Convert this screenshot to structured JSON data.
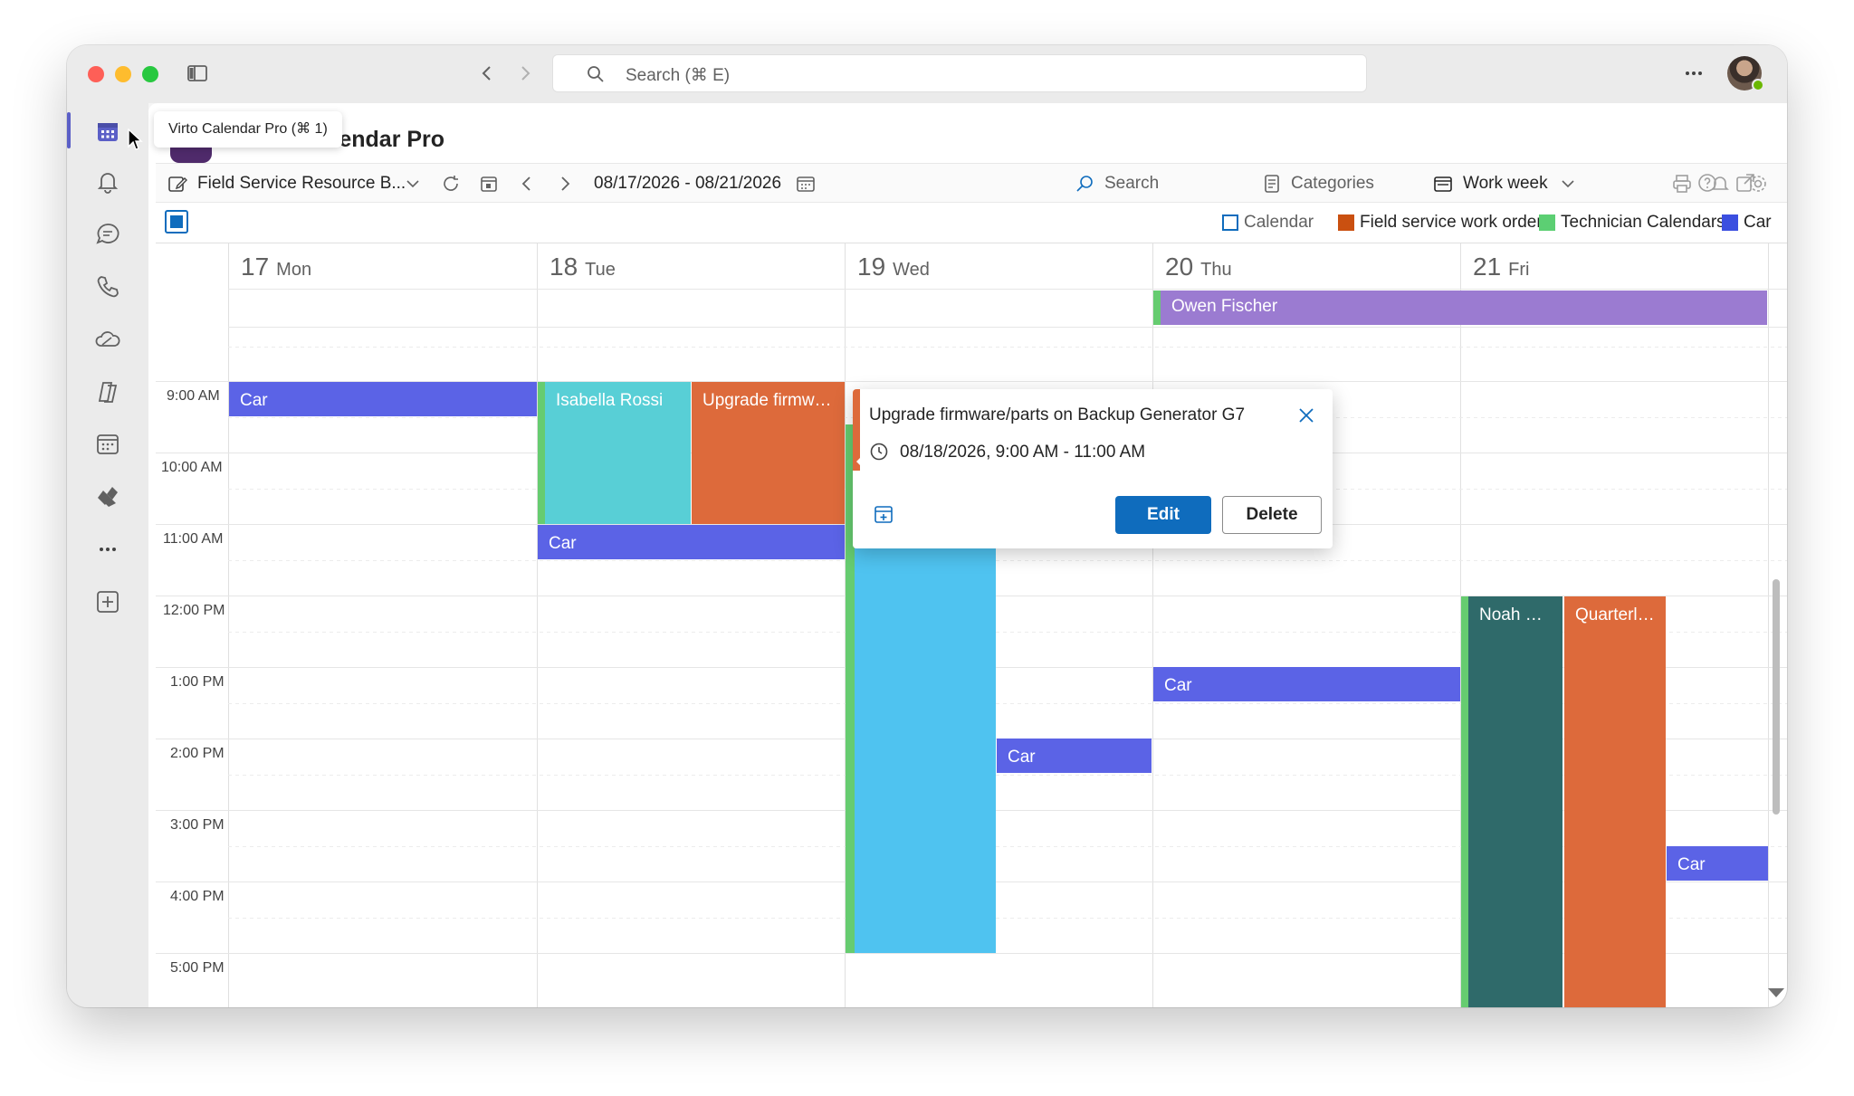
{
  "titlebar": {
    "search_placeholder": "Search (⌘ E)"
  },
  "tooltip": "Virto Calendar Pro (⌘ 1)",
  "rail": {
    "icons": [
      "calendar-icon",
      "bell-icon",
      "chat-icon",
      "phone-icon",
      "onedrive-icon",
      "copilot-icon",
      "calendar-grid-icon",
      "virto-icon",
      "more-icon",
      "add-app-icon"
    ]
  },
  "app": {
    "title": "Virto Calendar Pro"
  },
  "toolbar": {
    "calendar_name": "Field Service Resource B...",
    "date_range": "08/17/2026 - 08/21/2026",
    "search_label": "Search",
    "categories_label": "Categories",
    "view_label": "Work week"
  },
  "legend": [
    {
      "label": "Calendar",
      "color": "#0f6cbd",
      "outlined": true
    },
    {
      "label": "Field service work orders",
      "color": "#ca5010"
    },
    {
      "label": "Technician Calendars",
      "color": "#5ccf73"
    },
    {
      "label": "Car",
      "color": "#3b4fe0"
    }
  ],
  "days": [
    {
      "num": "17",
      "name": "Mon"
    },
    {
      "num": "18",
      "name": "Tue"
    },
    {
      "num": "19",
      "name": "Wed"
    },
    {
      "num": "20",
      "name": "Thu"
    },
    {
      "num": "21",
      "name": "Fri"
    }
  ],
  "times": [
    "9:00 AM",
    "10:00 AM",
    "11:00 AM",
    "12:00 PM",
    "1:00 PM",
    "2:00 PM",
    "3:00 PM",
    "4:00 PM",
    "5:00 PM"
  ],
  "events": {
    "allday_owen": "Owen Fischer",
    "mon_car": "Car",
    "tue_isabella": "Isabella Rossi",
    "tue_upgrade": "Upgrade firmwa...",
    "tue_car": "Car",
    "wed_car": "Car",
    "thu_car": "Car",
    "fri_noah": "Noah Patel",
    "fri_quarterly": "Quarterly...",
    "fri_car": "Car"
  },
  "popup": {
    "title": "Upgrade firmware/parts on Backup Generator G7",
    "time": "08/18/2026, 9:00 AM - 11:00 AM",
    "edit_label": "Edit",
    "delete_label": "Delete"
  }
}
